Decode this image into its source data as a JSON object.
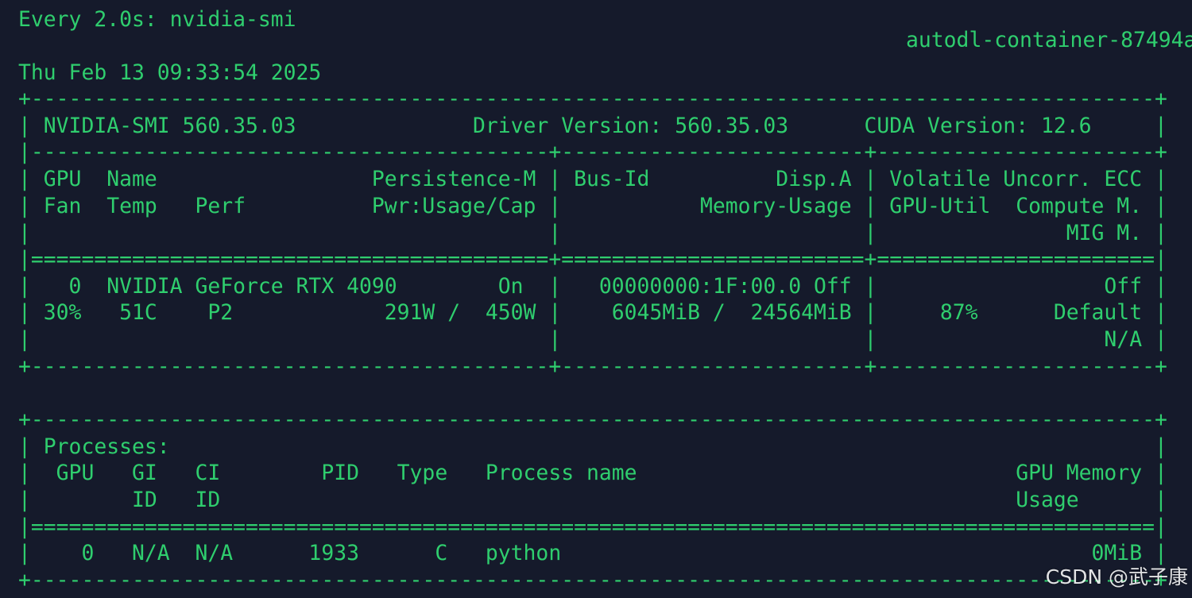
{
  "theme": {
    "background": "#151a2b",
    "text_color": "#2fce6e",
    "watermark_color": "#ffffff"
  },
  "header": {
    "watch_command": "Every 2.0s: nvidia-smi",
    "hostname": "autodl-container-87494a",
    "timestamp": "Thu Feb 13 09:33:54 2025"
  },
  "smi_table": {
    "border_top": "+-----------------------------------------------------------------------------------------+",
    "summary_row": "| NVIDIA-SMI 560.35.03              Driver Version: 560.35.03      CUDA Version: 12.6     |",
    "summary_divider": "|-----------------------------------------+------------------------+----------------------+",
    "header_row_1": "| GPU  Name                 Persistence-M | Bus-Id          Disp.A | Volatile Uncorr. ECC |",
    "header_row_2": "| Fan  Temp   Perf          Pwr:Usage/Cap |           Memory-Usage | GPU-Util  Compute M. |",
    "header_row_3": "|                                         |                        |               MIG M. |",
    "header_divider": "|=========================================+========================+======================|",
    "gpu_row_1": "|   0  NVIDIA GeForce RTX 4090        On  |   00000000:1F:00.0 Off |                  Off |",
    "gpu_row_2": "| 30%   51C    P2            291W /  450W |    6045MiB /  24564MiB |     87%      Default |",
    "gpu_row_3": "|                                         |                        |                  N/A |",
    "border_bottom": "+-----------------------------------------+------------------------+----------------------+"
  },
  "processes_table": {
    "border_top": "+-----------------------------------------------------------------------------------------+",
    "title_row": "| Processes:                                                                              |",
    "header_row_1": "|  GPU   GI   CI        PID   Type   Process name                              GPU Memory |",
    "header_row_2": "|        ID   ID                                                               Usage      |",
    "header_divider": "|=========================================================================================|",
    "process_row_1": "|    0   N/A  N/A      1933      C   python                                          0MiB |",
    "border_bottom": "+-----------------------------------------------------------------------------------------+"
  },
  "watermark": {
    "text": "CSDN @武子康"
  }
}
